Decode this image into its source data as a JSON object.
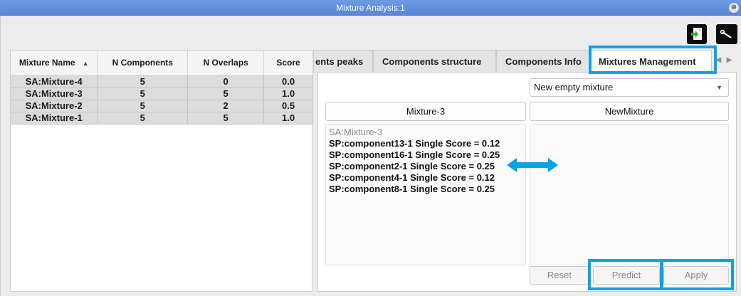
{
  "window": {
    "title": "Mixture Analysis:1",
    "close_symbol": "⊗"
  },
  "toolbar": {
    "export_icon": "export-icon",
    "settings_icon": "wrench-icon"
  },
  "table": {
    "columns": [
      "Mixture Name",
      "N Components",
      "N Overlaps",
      "Score"
    ],
    "sort_indicator": "▲",
    "rows": [
      [
        "SA:Mixture-4",
        "5",
        "0",
        "0.0"
      ],
      [
        "SA:Mixture-3",
        "5",
        "5",
        "1.0"
      ],
      [
        "SA:Mixture-2",
        "5",
        "2",
        "0.5"
      ],
      [
        "SA:Mixture-1",
        "5",
        "5",
        "1.0"
      ]
    ]
  },
  "tabs": [
    {
      "label": "ents peaks"
    },
    {
      "label": "Components structure"
    },
    {
      "label": "Components Info"
    },
    {
      "label": "Mixtures Management",
      "active": true
    }
  ],
  "tab_scroll": {
    "left": "◀",
    "right": "▶"
  },
  "management": {
    "dropdown_value": "New empty mixture",
    "left_header": "Mixture-3",
    "right_header": "NewMixture",
    "left_title": "SA:Mixture-3",
    "left_items": [
      "SP:component13-1 Single Score = 0.12",
      "SP:component16-1 Single Score = 0.25",
      "SP:component2-1 Single Score = 0.25",
      "SP:component4-1 Single Score = 0.12",
      "SP:component8-1 Single Score = 0.25"
    ],
    "buttons": {
      "reset": "Reset",
      "predict": "Predict",
      "apply": "Apply"
    }
  },
  "colors": {
    "highlight": "#0aa3e8",
    "titlebar": "#5a86d3"
  }
}
